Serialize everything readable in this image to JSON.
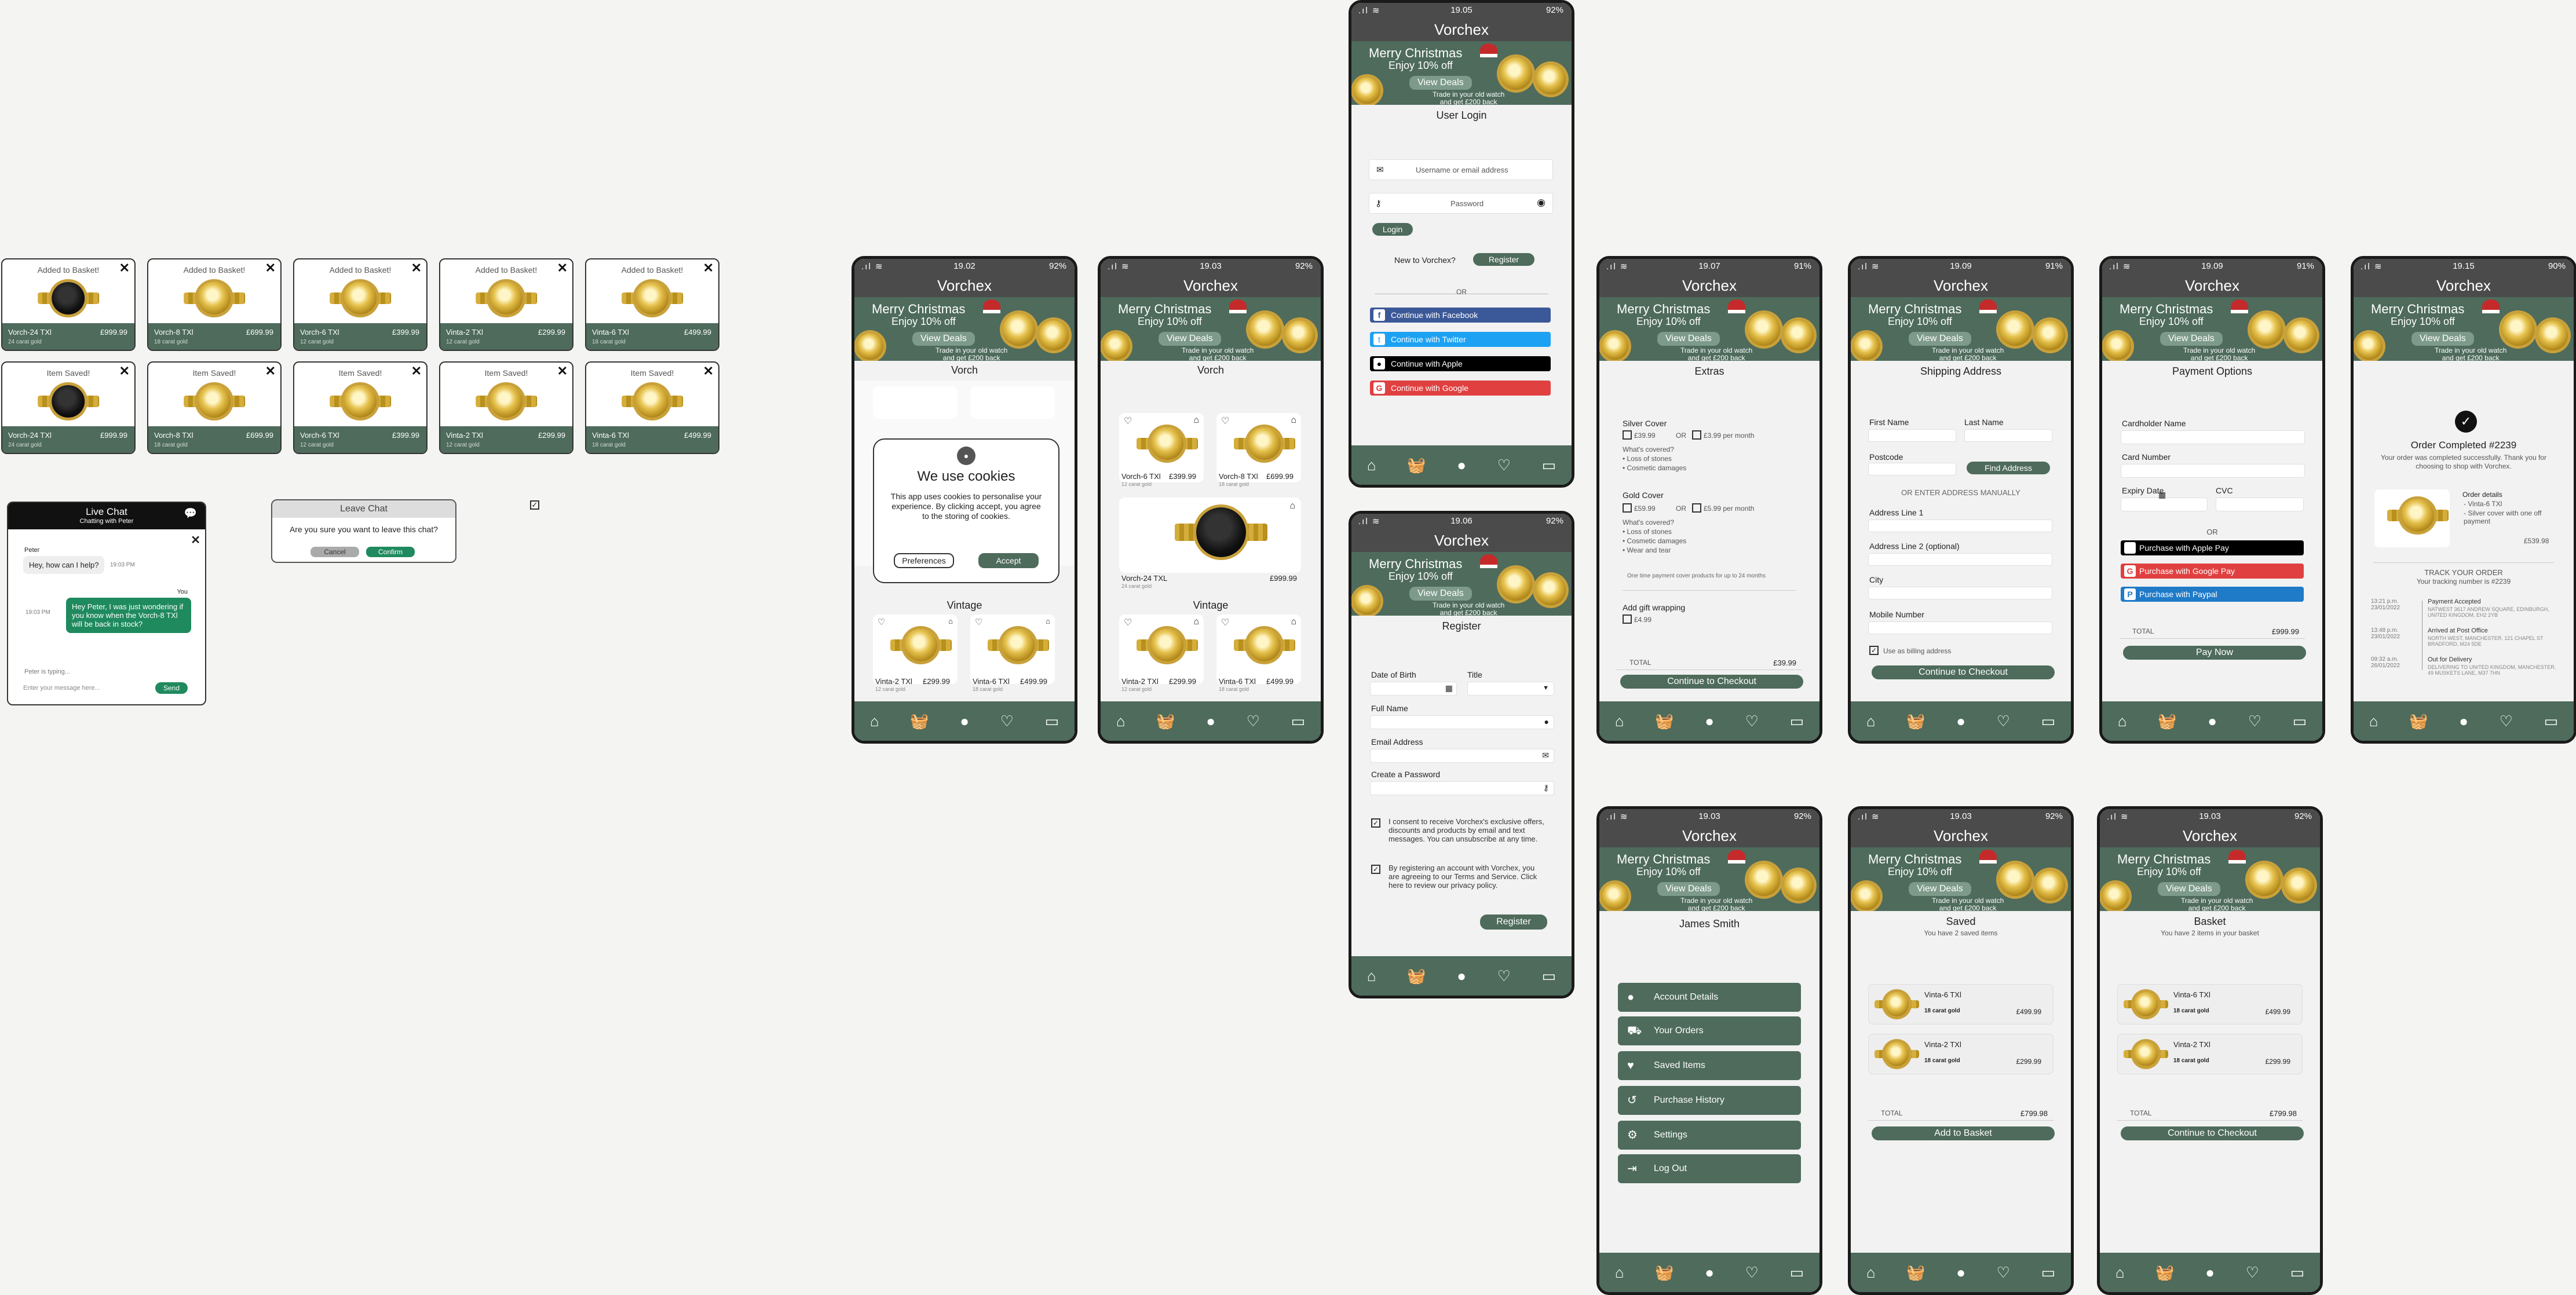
{
  "brand": "Vorchex",
  "banner": {
    "line1": "Merry Christmas",
    "line2": "Enjoy 10% off",
    "button": "View Deals",
    "trade1": "Trade in your old watch",
    "trade2": "and get £200 back"
  },
  "toasts": [
    {
      "title": "Added to Basket!",
      "name": "Vorch-24 TXl",
      "price": "£999.99",
      "sub": "24 carat gold",
      "black": true
    },
    {
      "title": "Added to Basket!",
      "name": "Vorch-8 TXl",
      "price": "£699.99",
      "sub": "18 carat gold",
      "black": false
    },
    {
      "title": "Added to Basket!",
      "name": "Vorch-6 TXl",
      "price": "£399.99",
      "sub": "12 carat gold",
      "black": false
    },
    {
      "title": "Added to Basket!",
      "name": "Vinta-2 TXl",
      "price": "£299.99",
      "sub": "12 carat gold",
      "black": false
    },
    {
      "title": "Added to Basket!",
      "name": "Vinta-6 TXl",
      "price": "£499.99",
      "sub": "18 carat gold",
      "black": false
    },
    {
      "title": "Item Saved!",
      "name": "Vorch-24 TXl",
      "price": "£999.99",
      "sub": "24 carat gold",
      "black": true
    },
    {
      "title": "Item Saved!",
      "name": "Vorch-8 TXl",
      "price": "£699.99",
      "sub": "18 carat gold",
      "black": false
    },
    {
      "title": "Item Saved!",
      "name": "Vorch-6 TXl",
      "price": "£399.99",
      "sub": "12 carat gold",
      "black": false
    },
    {
      "title": "Item Saved!",
      "name": "Vinta-2 TXl",
      "price": "£299.99",
      "sub": "12 carat gold",
      "black": false
    },
    {
      "title": "Item Saved!",
      "name": "Vinta-6 TXl",
      "price": "£499.99",
      "sub": "18 carat gold",
      "black": false
    }
  ],
  "chat": {
    "title": "Live Chat",
    "sub": "Chatting with Peter",
    "agent": "Peter",
    "agent_msg": "Hey, how can I help?",
    "agent_time": "19:03 PM",
    "you": "You",
    "user_msg": "Hey Peter, I was just wondering if you know when the Vorch-8 TXl will be back in stock?",
    "user_time": "19:03 PM",
    "typing": "Peter is typing...",
    "placeholder": "Enter your message here...",
    "send": "Send"
  },
  "leave": {
    "title": "Leave Chat",
    "text": "Are you sure you want to leave this chat?",
    "cancel": "Cancel",
    "confirm": "Confirm"
  },
  "cookies": {
    "time": "19.02",
    "battery": "92%",
    "section": "Vorch",
    "title": "We use cookies",
    "text": "This app uses cookies to personalise your experience. By clicking accept, you agree to the storing of cookies.",
    "pref": "Preferences",
    "accept": "Accept",
    "vintage": "Vintage",
    "p1n": "Vinta-2 TXl",
    "p1p": "£299.99",
    "p2n": "Vinta-6 TXl",
    "p2p": "£499.99",
    "gold12": "12 carat gold",
    "gold18": "18 carat gold"
  },
  "shop": {
    "time": "19.03",
    "battery": "92%",
    "section": "Vorch",
    "a_n": "Vorch-6 TXl",
    "a_p": "£399.99",
    "a_s": "12 carat gold",
    "b_n": "Vorch-8 TXl",
    "b_p": "£699.99",
    "b_s": "18 carat gold",
    "c_n": "Vorch-24 TXL",
    "c_p": "£999.99",
    "c_s": "24 carat gold",
    "vintage": "Vintage",
    "d_n": "Vinta-2 TXl",
    "d_p": "£299.99",
    "d_s": "12 carat gold",
    "e_n": "Vinta-6 TXl",
    "e_p": "£499.99",
    "e_s": "18 carat gold"
  },
  "login": {
    "time": "19.05",
    "battery": "92%",
    "title": "User Login",
    "user_ph": "Username or email address",
    "pass_ph": "Password",
    "login": "Login",
    "new": "New to Vorchex?",
    "register": "Register",
    "or": "OR",
    "fb": "Continue with Facebook",
    "tw": "Continue with Twitter",
    "ap": "Continue with Apple",
    "go": "Continue with Google"
  },
  "register": {
    "time": "19.06",
    "battery": "92%",
    "title": "Register",
    "dob": "Date of Birth",
    "title_lbl": "Title",
    "full": "Full Name",
    "email": "Email Address",
    "pass": "Create a Password",
    "consent": "I consent to receive Vorchex's exclusive offers, discounts and products by email and text messages. You can unsubscribe at any time.",
    "terms": "By registering an account with Vorchex, you are agreeing to our Terms and Service. Click here to review our privacy policy.",
    "btn": "Register"
  },
  "extras": {
    "time": "19.07",
    "battery": "91%",
    "title": "Extras",
    "silver": "Silver Cover",
    "s1": "£39.99",
    "or": "OR",
    "s2": "£3.99 per month",
    "covered": "What's covered?",
    "sc1": "• Loss of stones",
    "sc2": "• Cosmetic damages",
    "gold": "Gold Cover",
    "g1": "£59.99",
    "g2": "£5.99 per month",
    "gc1": "• Loss of stones",
    "gc2": "• Cosmetic damages",
    "gc3": "• Wear and tear",
    "note": "One time payment cover products for up to 24 months",
    "gift": "Add gift wrapping",
    "giftp": "£4.99",
    "total": "TOTAL",
    "totalv": "£39.99",
    "btn": "Continue to Checkout"
  },
  "shipping": {
    "time": "19.09",
    "battery": "91%",
    "title": "Shipping Address",
    "first": "First Name",
    "last": "Last Name",
    "post": "Postcode",
    "find": "Find Address",
    "manual": "OR ENTER ADDRESS MANUALLY",
    "a1": "Address Line 1",
    "a2": "Address Line 2 (optional)",
    "city": "City",
    "mobile": "Mobile Number",
    "billing": "Use as billing address",
    "btn": "Continue to Checkout"
  },
  "payment": {
    "time": "19.09",
    "battery": "91%",
    "title": "Payment Options",
    "holder": "Cardholder Name",
    "number": "Card Number",
    "expiry": "Expiry Date",
    "cvc": "CVC",
    "or": "OR",
    "apple": "Purchase with Apple Pay",
    "google": "Purchase with Google Pay",
    "paypal": "Purchase with Paypal",
    "total": "TOTAL",
    "totalv": "£999.99",
    "btn": "Pay Now"
  },
  "order": {
    "time": "19.15",
    "battery": "90%",
    "title": "Order Completed #2239",
    "thanks": "Your order was completed successfully. Thank you for choosing to shop with Vorchex.",
    "details": "Order details",
    "d1": "- Vinta-6 TXl",
    "d2": "- Silver cover with one off payment",
    "price": "£539.98",
    "track": "TRACK YOUR ORDER",
    "tracknum": "Your tracking number is #2239",
    "e1t": "13:21 p.m. 23/01/2022",
    "e1h": "Payment Accepted",
    "e1d": "NATWEST 3617 ANDREW SQUARE, EDINBURGH, UNITED KINGDOM, EH2 2YB",
    "e2t": "13:48 p.m. 23/01/2022",
    "e2h": "Arrived at Post Office",
    "e2d": "NORTH WEST, MANCHESTER, 121 CHAPEL ST BRADFORD, M24 5DE",
    "e3t": "09:32 a.m. 26/01/2022",
    "e3h": "Out for Delivery",
    "e3d": "DELIVERING TO UNITED KINGDOM, MANCHESTER, 49 MUSKETS LANE, M37 7HN"
  },
  "account": {
    "time": "19.03",
    "battery": "92%",
    "name": "James Smith",
    "m1": "Account Details",
    "m2": "Your Orders",
    "m3": "Saved Items",
    "m4": "Purchase History",
    "m5": "Settings",
    "m6": "Log Out"
  },
  "saved": {
    "time": "19.03",
    "battery": "92%",
    "title": "Saved",
    "sub": "You have 2 saved items",
    "i1": "Vinta-6 TXl",
    "i1s": "18 carat gold",
    "i1p": "£499.99",
    "i2": "Vinta-2 TXl",
    "i2s": "18 carat gold",
    "i2p": "£299.99",
    "total": "TOTAL",
    "totalv": "£799.98",
    "btn": "Add to Basket"
  },
  "basket": {
    "time": "19.03",
    "battery": "92%",
    "title": "Basket",
    "sub": "You have 2 items in your basket",
    "i1": "Vinta-6 TXl",
    "i1s": "18 carat gold",
    "i1p": "£499.99",
    "i2": "Vinta-2 TXl",
    "i2s": "18 carat gold",
    "i2p": "£299.99",
    "total": "TOTAL",
    "totalv": "£799.98",
    "btn": "Continue to Checkout"
  },
  "colors": {
    "green": "#4e6b5c",
    "dark": "#4b4b4b",
    "accent": "#1f8a5e",
    "facebook": "#3b5998",
    "twitter": "#1da1f2",
    "apple": "#000000",
    "google": "#e04040"
  }
}
